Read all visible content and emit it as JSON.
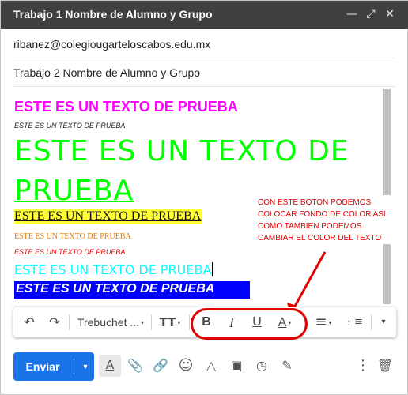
{
  "window": {
    "title": "Trabajo 1 Nombre de Alumno y Grupo",
    "minimize_glyph": "—",
    "popout_glyph": "⤢",
    "close_glyph": "✕"
  },
  "fields": {
    "to": "ribanez@colegiougarteloscabos.edu.mx",
    "subject_prefix": "Trabajo ",
    "subject_number": "2",
    "subject_suffix": " Nombre  de Alumno y Grupo"
  },
  "body": {
    "lines": [
      "ESTE ES UN TEXTO DE PRUEBA",
      "ESTE ES UN TEXTO DE PRUEBA",
      "ESTE ES UN TEXTO DE",
      "PRUEBA ",
      "ESTE ES UN TEXTO DE PRUEBA",
      "ESTE ES UN TEXTO DE PRUEBA",
      "ESTE ES UN TEXTO DE PRUEBA",
      "ESTE ES UN TEXTO DE PRUEBA",
      "ESTE ES UN TEXTO DE PRUEBA"
    ]
  },
  "annotation": {
    "lines": [
      "CON ESTE BOTON PODEMOS",
      "COLOCAR FONDO DE COLOR ASI",
      "COMO TAMBIEN PODEMOS",
      "CAMBIAR EL COLOR DEL TEXTO"
    ],
    "color": "#e00000"
  },
  "toolbar": {
    "undo_glyph": "↶",
    "redo_glyph": "↷",
    "font_name": "Trebuchet ...",
    "size_glyph": "TT",
    "bold_glyph": "B",
    "italic_glyph": "I",
    "underline_glyph": "U",
    "text_color_glyph": "A",
    "align_glyph": "≡",
    "numbered_list_glyph": "⋮≡",
    "dropdown_glyph": "▾"
  },
  "bottom": {
    "send_label": "Enviar",
    "send_dropdown_glyph": "▼",
    "format_glyph": "A",
    "attach_glyph": "📎",
    "link_glyph": "🔗",
    "emoji_glyph": "☺",
    "drive_glyph": "△",
    "photo_glyph": "▣",
    "confidential_glyph": "◷",
    "signature_glyph": "✎",
    "more_glyph": "⋮",
    "delete_glyph": "🗑"
  },
  "colors": {
    "titlebar": "#404040",
    "accent": "#1a73e8",
    "magenta": "#ff00ff",
    "green": "#00ff00",
    "yellow": "#ffff33",
    "orange": "#e07b00",
    "red": "#e00000",
    "cyan": "#00ffff",
    "blue": "#0000ff"
  }
}
